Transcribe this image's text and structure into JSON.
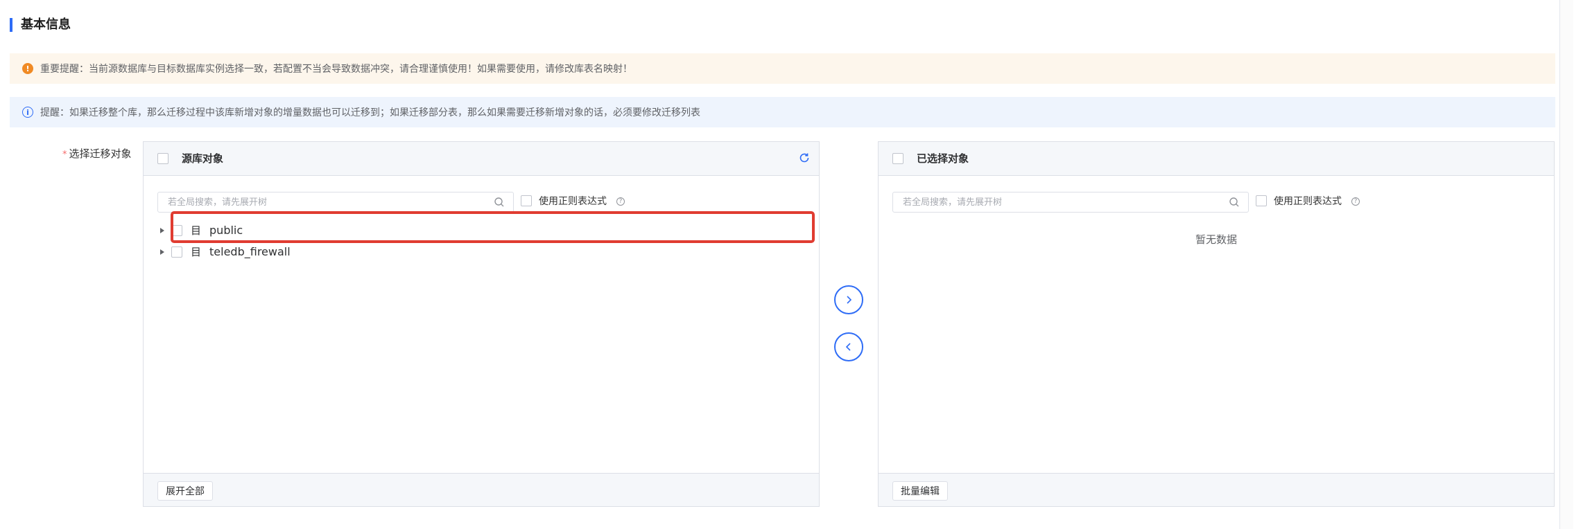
{
  "section": {
    "title": "基本信息"
  },
  "alerts": {
    "warning": "重要提醒：当前源数据库与目标数据库实例选择一致，若配置不当会导致数据冲突，请合理谨慎使用！如果需要使用，请修改库表名映射！",
    "info": "提醒：如果迁移整个库，那么迁移过程中该库新增对象的增量数据也可以迁移到；如果迁移部分表，那么如果需要迁移新增对象的话，必须要修改迁移列表"
  },
  "form": {
    "required_mark": "*",
    "label": "选择迁移对象"
  },
  "source_panel": {
    "title": "源库对象",
    "search_placeholder": "若全局搜索，请先展开树",
    "regex_label": "使用正则表达式",
    "tree": [
      {
        "label": "public",
        "icon": "database-icon"
      },
      {
        "label": "teledb_firewall",
        "icon": "database-icon"
      }
    ],
    "footer_button": "展开全部"
  },
  "target_panel": {
    "title": "已选择对象",
    "search_placeholder": "若全局搜索，请先展开树",
    "regex_label": "使用正则表达式",
    "empty_text": "暂无数据",
    "footer_button": "批量编辑"
  },
  "colors": {
    "accent": "#2e6cf6",
    "warning": "#f08a24",
    "highlight": "#e03c31"
  }
}
